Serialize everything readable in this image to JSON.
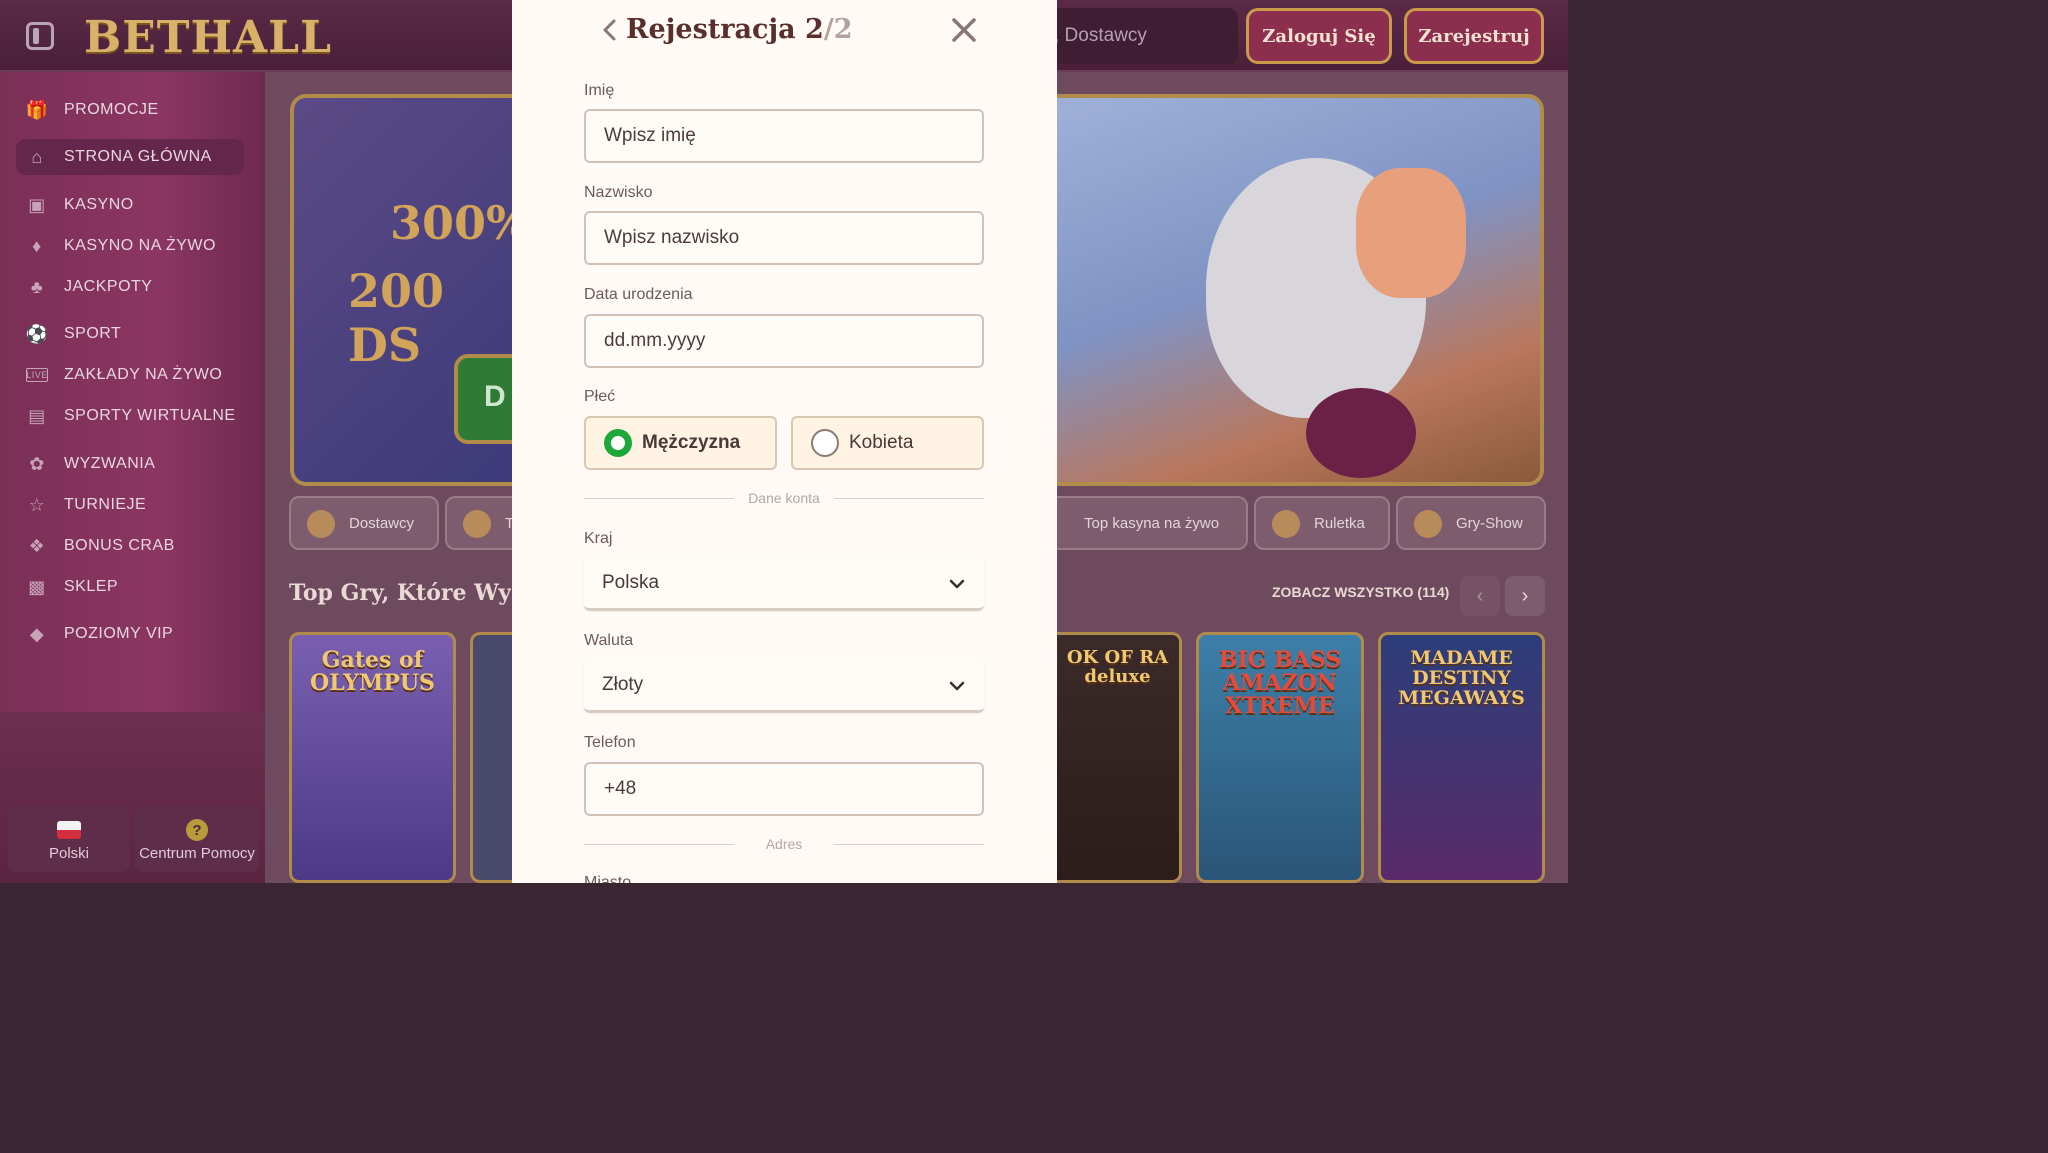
{
  "header": {
    "logo": "BETHALL",
    "search_placeholder_fragment": ", Dostawcy",
    "login_label": "Zaloguj Się",
    "register_label": "Zarejestruj"
  },
  "sidebar": {
    "items": [
      {
        "label": "PROMOCJE",
        "icon": "gift-icon"
      },
      {
        "label": "STRONA GŁÓWNA",
        "icon": "home-icon"
      },
      {
        "label": "KASYNO",
        "icon": "slot-machine-icon"
      },
      {
        "label": "KASYNO NA ŻYWO",
        "icon": "card-icon"
      },
      {
        "label": "JACKPOTY",
        "icon": "clover-icon"
      },
      {
        "label": "SPORT",
        "icon": "ball-icon"
      },
      {
        "label": "ZAKŁADY NA ŻYWO",
        "icon": "live-icon"
      },
      {
        "label": "SPORTY WIRTUALNE",
        "icon": "virtual-icon"
      },
      {
        "label": "WYZWANIA",
        "icon": "medal-icon"
      },
      {
        "label": "TURNIEJE",
        "icon": "trophy-icon"
      },
      {
        "label": "BONUS CRAB",
        "icon": "crab-icon"
      },
      {
        "label": "SKLEP",
        "icon": "basket-icon"
      },
      {
        "label": "POZIOMY VIP",
        "icon": "diamond-icon"
      }
    ],
    "language_label": "Polski",
    "help_label": "Centrum Pomocy",
    "help_glyph": "?"
  },
  "banner": {
    "promo_line1": "300%",
    "promo_line2": "200 DS",
    "button_fragment": "D"
  },
  "chips": {
    "providers": "Dostawcy",
    "fragment": "T",
    "top_live": "Top kasyna na żywo",
    "roulette": "Ruletka",
    "game_shows": "Gry-Show"
  },
  "games_section": {
    "title": "Top Gry, Które Wybra",
    "see_all": "ZOBACZ WSZYSTKO (114)",
    "cards": [
      {
        "title": "Gates of\nOLYMPUS"
      },
      {
        "title": ""
      },
      {
        "title": "OK OF RA\ndeluxe"
      },
      {
        "title": "BIG BASS\nAMAZON\nXTREME"
      },
      {
        "title": "MADAME\nDESTINY\nMEGAWAYS"
      }
    ]
  },
  "modal": {
    "title_main": "Rejestracja 2",
    "title_sep": "/",
    "title_total": "2",
    "fields": {
      "first_name": {
        "label": "Imię",
        "placeholder": "Wpisz imię"
      },
      "last_name": {
        "label": "Nazwisko",
        "placeholder": "Wpisz nazwisko"
      },
      "birth_date": {
        "label": "Data urodzenia",
        "placeholder": "dd.mm.yyyy"
      },
      "gender": {
        "label": "Płeć",
        "options": [
          {
            "label": "Mężczyzna",
            "selected": true
          },
          {
            "label": "Kobieta",
            "selected": false
          }
        ]
      },
      "account_section": "Dane konta",
      "country": {
        "label": "Kraj",
        "value": "Polska"
      },
      "currency": {
        "label": "Waluta",
        "value": "Złoty"
      },
      "phone": {
        "label": "Telefon",
        "value": "+48"
      },
      "address_section": "Adres",
      "city": {
        "label": "Miasto"
      }
    }
  },
  "colors": {
    "accent_green": "#1fa83a",
    "title_brown": "#5a2e2a",
    "modal_bg": "#fffaf5"
  }
}
